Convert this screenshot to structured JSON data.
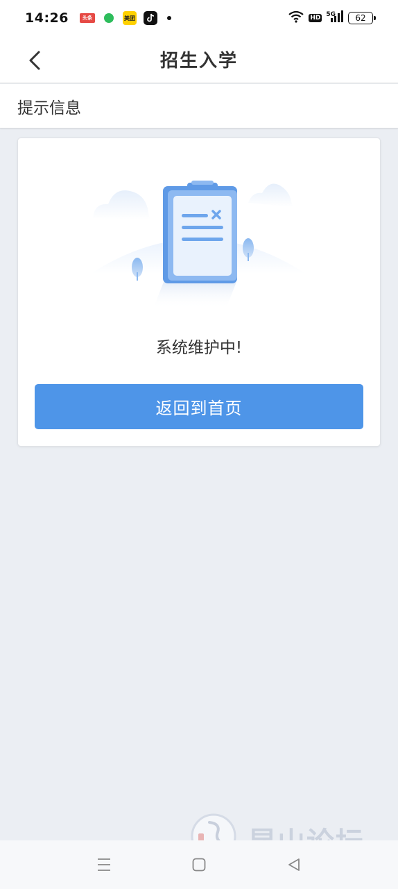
{
  "status_bar": {
    "time": "14:26",
    "apps": [
      {
        "name": "toutiao-icon",
        "label": "头条"
      },
      {
        "name": "wechat-icon",
        "label": ""
      },
      {
        "name": "meituan-icon",
        "label": "美团"
      },
      {
        "name": "douyin-icon",
        "label": ""
      }
    ],
    "hd": "HD",
    "network": "5G",
    "battery": "62"
  },
  "header": {
    "title": "招生入学",
    "back_icon": "chevron-left-icon"
  },
  "section": {
    "title": "提示信息"
  },
  "card": {
    "message": "系统维护中!",
    "button_label": "返回到首页",
    "illustration_icon": "clipboard-error-icon"
  },
  "watermark": {
    "text": "昆山论坛"
  },
  "nav_bar": {
    "icons": [
      "menu-icon",
      "home-square-icon",
      "back-triangle-icon"
    ]
  },
  "colors": {
    "accent": "#4e95e8",
    "background": "#ebeef3",
    "card": "#ffffff"
  }
}
